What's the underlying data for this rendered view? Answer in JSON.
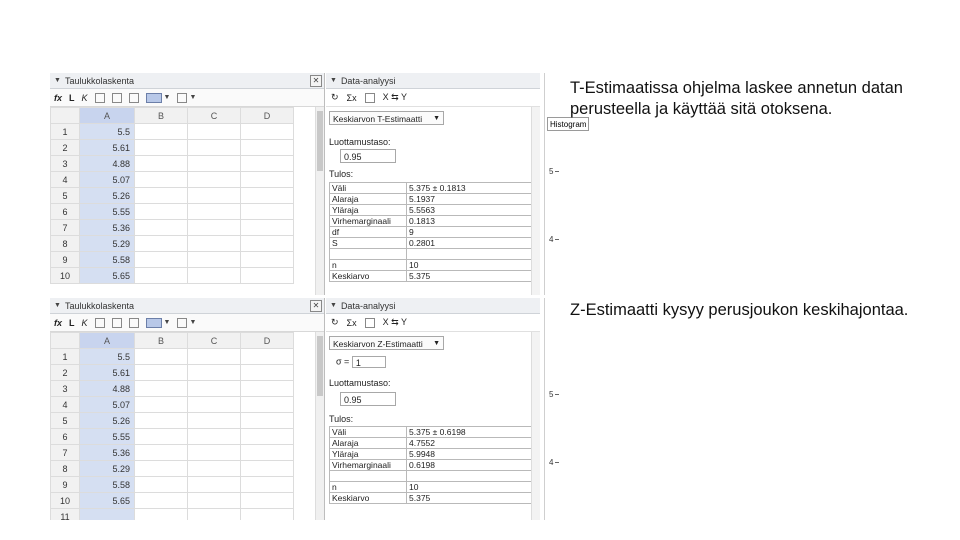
{
  "top": {
    "spreadsheet_title": "Taulukkolaskenta",
    "toolbar": {
      "fx": "fx",
      "bold": "L",
      "italic": "K"
    },
    "columns": [
      "A",
      "B",
      "C",
      "D"
    ],
    "rows": [
      {
        "n": "1",
        "a": "5.5"
      },
      {
        "n": "2",
        "a": "5.61"
      },
      {
        "n": "3",
        "a": "4.88"
      },
      {
        "n": "4",
        "a": "5.07"
      },
      {
        "n": "5",
        "a": "5.26"
      },
      {
        "n": "6",
        "a": "5.55"
      },
      {
        "n": "7",
        "a": "5.36"
      },
      {
        "n": "8",
        "a": "5.29"
      },
      {
        "n": "9",
        "a": "5.58"
      },
      {
        "n": "10",
        "a": "5.65"
      }
    ],
    "analysis_title": "Data-analyysi",
    "analysis_toolbar": {
      "stats": "Σx",
      "swap": "X ⇆ Y"
    },
    "method": "Keskiarvon T-Estimaatti",
    "confidence_label": "Luottamustaso:",
    "confidence_value": "0.95",
    "result_label": "Tulos:",
    "results": [
      {
        "k": "Väli",
        "v": "5.375 ± 0.1813"
      },
      {
        "k": "Alaraja",
        "v": "5.1937"
      },
      {
        "k": "Yläraja",
        "v": "5.5563"
      },
      {
        "k": "Virhemarginaali",
        "v": "0.1813"
      },
      {
        "k": "df",
        "v": "9"
      },
      {
        "k": "S",
        "v": "0.2801"
      },
      {
        "k": "",
        "v": ""
      },
      {
        "k": "n",
        "v": "10"
      },
      {
        "k": "Keskiarvo",
        "v": "5.375"
      }
    ],
    "histogram_tab": "Histogram",
    "ticks": [
      "5",
      "4"
    ]
  },
  "bottom": {
    "spreadsheet_title": "Taulukkolaskenta",
    "toolbar": {
      "fx": "fx",
      "bold": "L",
      "italic": "K"
    },
    "columns": [
      "A",
      "B",
      "C",
      "D"
    ],
    "rows": [
      {
        "n": "1",
        "a": "5.5"
      },
      {
        "n": "2",
        "a": "5.61"
      },
      {
        "n": "3",
        "a": "4.88"
      },
      {
        "n": "4",
        "a": "5.07"
      },
      {
        "n": "5",
        "a": "5.26"
      },
      {
        "n": "6",
        "a": "5.55"
      },
      {
        "n": "7",
        "a": "5.36"
      },
      {
        "n": "8",
        "a": "5.29"
      },
      {
        "n": "9",
        "a": "5.58"
      },
      {
        "n": "10",
        "a": "5.65"
      },
      {
        "n": "11",
        "a": ""
      }
    ],
    "analysis_title": "Data-analyysi",
    "analysis_toolbar": {
      "stats": "Σx",
      "swap": "X ⇆ Y"
    },
    "method": "Keskiarvon Z-Estimaatti",
    "sigma_label": "σ =",
    "sigma_value": "1",
    "confidence_label": "Luottamustaso:",
    "confidence_value": "0.95",
    "result_label": "Tulos:",
    "results": [
      {
        "k": "Väli",
        "v": "5.375 ± 0.6198"
      },
      {
        "k": "Alaraja",
        "v": "4.7552"
      },
      {
        "k": "Yläraja",
        "v": "5.9948"
      },
      {
        "k": "Virhemarginaali",
        "v": "0.6198"
      },
      {
        "k": "",
        "v": ""
      },
      {
        "k": "n",
        "v": "10"
      },
      {
        "k": "Keskiarvo",
        "v": "5.375"
      }
    ],
    "ticks": [
      "5",
      "4"
    ]
  },
  "notes": {
    "t_estimate": "T-Estimaatissa ohjelma laskee annetun datan perusteella ja käyttää sitä otoksena.",
    "z_estimate": "Z-Estimaatti kysyy perusjoukon keskihajontaa."
  },
  "colors": {
    "selected_column": "#d5dff2",
    "header_bg": "#f1f1f1"
  }
}
